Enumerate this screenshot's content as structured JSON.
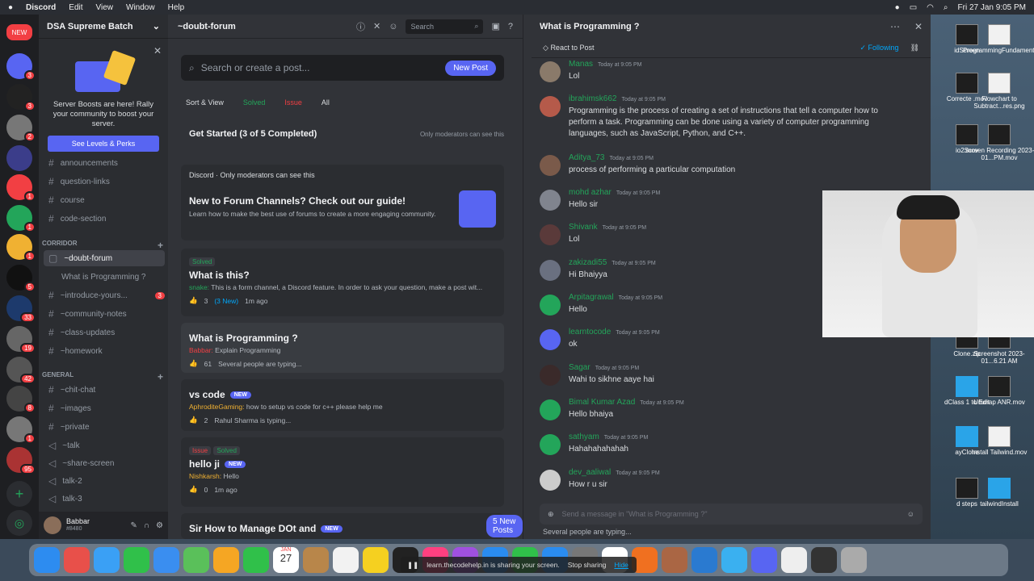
{
  "menubar": {
    "apple": "",
    "app": "Discord",
    "items": [
      "Edit",
      "View",
      "Window",
      "Help"
    ],
    "clock": "Fri 27 Jan 9:05 PM"
  },
  "server": {
    "name": "DSA Supreme Batch"
  },
  "boost": {
    "text": "Server Boosts are here! Rally your community to boost your server.",
    "button": "See Levels & Perks"
  },
  "channels": {
    "top": [
      {
        "label": "announcements"
      },
      {
        "label": "question-links"
      },
      {
        "label": "course"
      },
      {
        "label": "code-section"
      }
    ],
    "corridor_label": "CORRIDOR",
    "corridor": [
      {
        "label": "~doubt-forum",
        "active": true
      },
      {
        "label": "What is Programming ?"
      },
      {
        "label": "~introduce-yours...",
        "badge": "3"
      },
      {
        "label": "~community-notes"
      },
      {
        "label": "~class-updates"
      },
      {
        "label": "~homework"
      }
    ],
    "general_label": "GENERAL",
    "general": [
      {
        "label": "~chit-chat"
      },
      {
        "label": "~images"
      },
      {
        "label": "~private"
      },
      {
        "label": "~talk"
      },
      {
        "label": "~share-screen"
      },
      {
        "label": "talk-2"
      },
      {
        "label": "talk-3"
      }
    ]
  },
  "user": {
    "name": "Babbar",
    "tag": "#8480"
  },
  "forum": {
    "channel": "~doubt-forum",
    "search_label": "Search",
    "search_placeholder": "Search or create a post...",
    "new_post": "New Post",
    "sort": "Sort & View",
    "filter_solved": "Solved",
    "filter_issue": "Issue",
    "filter_all": "All",
    "started": "Get Started  (3 of 5 Completed)",
    "mod_only": "Only moderators can see this",
    "guide_source": "Discord",
    "guide_title": "New to Forum Channels? Check out our guide!",
    "guide_sub": "Learn how to make the best use of forums to create a more engaging community.",
    "posts": [
      {
        "tag": "Solved",
        "title": "What is this?",
        "author": "snake:",
        "preview": "This is a form channel, a Discord feature. In order to ask your question, make a post wit...",
        "count": "3",
        "new": "(3 New)",
        "time": "1m ago"
      },
      {
        "title": "What is Programming ?",
        "author": "Babbar:",
        "preview": "Explain Programming",
        "count": "61",
        "typing": "Several people are typing..."
      },
      {
        "title": "vs code",
        "badge": "NEW",
        "author": "AphroditeGaming:",
        "preview": "how to setup vs code for c++ please help me",
        "count": "2",
        "typing": "Rahul Sharma is typing..."
      },
      {
        "tag": "Issue",
        "tag2": "Solved",
        "title": "hello ji",
        "badge": "NEW",
        "author": "Nishkarsh:",
        "preview": "Hello",
        "count": "0",
        "time": "1m ago"
      },
      {
        "title": "Sir How to Manage DOt and",
        "badge": "NEW"
      }
    ],
    "new_posts": "5 New Posts"
  },
  "chat": {
    "title": "What is Programming ?",
    "react": "React to Post",
    "following": "Following",
    "messages": [
      {
        "name": "Manas",
        "time": "Today at 9:05 PM",
        "text": "Lol",
        "color": "#23a55a"
      },
      {
        "name": "ibrahimsk662",
        "time": "Today at 9:05 PM",
        "text": "Programming is the process of creating a set of instructions that tell a computer how to perform a task. Programming can be done using a variety of computer programming languages, such as JavaScript, Python, and C++.",
        "color": "#23a55a"
      },
      {
        "name": "Aditya_73",
        "time": "Today at 9:05 PM",
        "text": "process of performing a particular computation",
        "color": "#23a55a"
      },
      {
        "name": "mohd azhar",
        "time": "Today at 9:05 PM",
        "text": "Hello sir",
        "color": "#23a55a"
      },
      {
        "name": "Shivank",
        "time": "Today at 9:05 PM",
        "text": "Lol",
        "color": "#23a55a"
      },
      {
        "name": "zakizadi55",
        "time": "Today at 9:05 PM",
        "text": "Hi Bhaiyya",
        "color": "#23a55a"
      },
      {
        "name": "Arpitagrawal",
        "time": "Today at 9:05 PM",
        "text": "Hello",
        "color": "#23a55a"
      },
      {
        "name": "learntocode",
        "time": "Today at 9:05 PM",
        "text": "ok",
        "color": "#23a55a"
      },
      {
        "name": "Sagar",
        "time": "Today at 9:05 PM",
        "text": "Wahi to sikhne aaye hai",
        "color": "#23a55a"
      },
      {
        "name": "Bimal Kumar Azad",
        "time": "Today at 9:05 PM",
        "text": "Hello bhaiya",
        "color": "#23a55a"
      },
      {
        "name": "sathyam",
        "time": "Today at 9:05 PM",
        "text": "Hahahahahahah",
        "color": "#23a55a"
      },
      {
        "name": "dev_aaliwal",
        "time": "Today at 9:05 PM",
        "text": "How r u sir",
        "color": "#23a55a"
      }
    ],
    "composer": "Send a message in \"What is Programming ?\"",
    "typing": "Several people are typing..."
  },
  "desktop": [
    {
      "label": "idScreen"
    },
    {
      "label": "ProgrammingFundamentalsDSA"
    },
    {
      "label": "Correcte .mov"
    },
    {
      "label": "Flowchart to Subtract...res.png"
    },
    {
      "label": "io2.mov"
    },
    {
      "label": "Screen Recording 2023-01...PM.mov"
    },
    {
      "label": "Clone.zip"
    },
    {
      "label": "Screenshot 2023-01...6.21 AM"
    },
    {
      "label": "dClass 1 to Edit"
    },
    {
      "label": "Unwrap ANR.mov"
    },
    {
      "label": "ayClone"
    },
    {
      "label": "Install Tailwind.mov"
    },
    {
      "label": "d steps"
    },
    {
      "label": "tailwindInstall"
    }
  ],
  "share": {
    "text": "learn.thecodehelp.in is sharing your screen.",
    "stop": "Stop sharing",
    "hide": "Hide"
  },
  "dock_date": "27",
  "dock_month": "JAN"
}
